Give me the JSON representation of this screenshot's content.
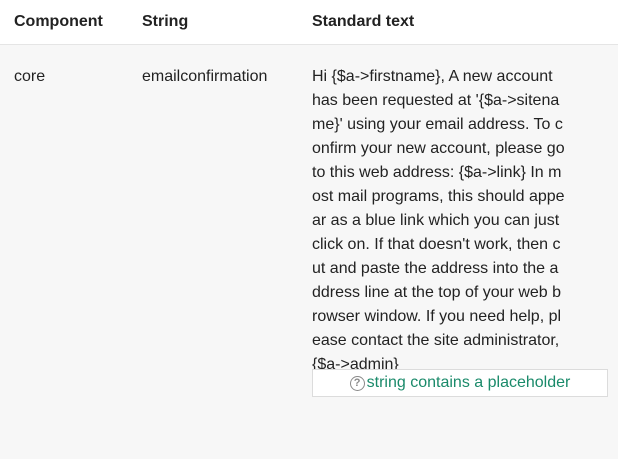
{
  "table": {
    "headers": {
      "component": "Component",
      "string": "String",
      "standard_text": "Standard text"
    },
    "row": {
      "component": "core",
      "string": "emailconfirmation",
      "standard_text_lines": [
        "Hi {$a->firstname}, A new account",
        "has been requested at '{$a->sitena",
        "me}' using your email address. To c",
        "onfirm your new account, please go",
        "to this web address: {$a->link} In m",
        "ost mail programs, this should appe",
        "ar as a blue link which you can just",
        "click on. If that doesn't work, then c",
        "ut and paste the address into the a",
        "ddress line at the top of your web b",
        "rowser window. If you need help, pl",
        "ease contact the site administrator,",
        "{$a->admin}"
      ],
      "placeholder_note": "string contains a placeholder",
      "help_icon": "question-circle-icon"
    }
  },
  "colors": {
    "placeholder_text": "#1a8a6a",
    "row_background": "#f7f7f7"
  }
}
